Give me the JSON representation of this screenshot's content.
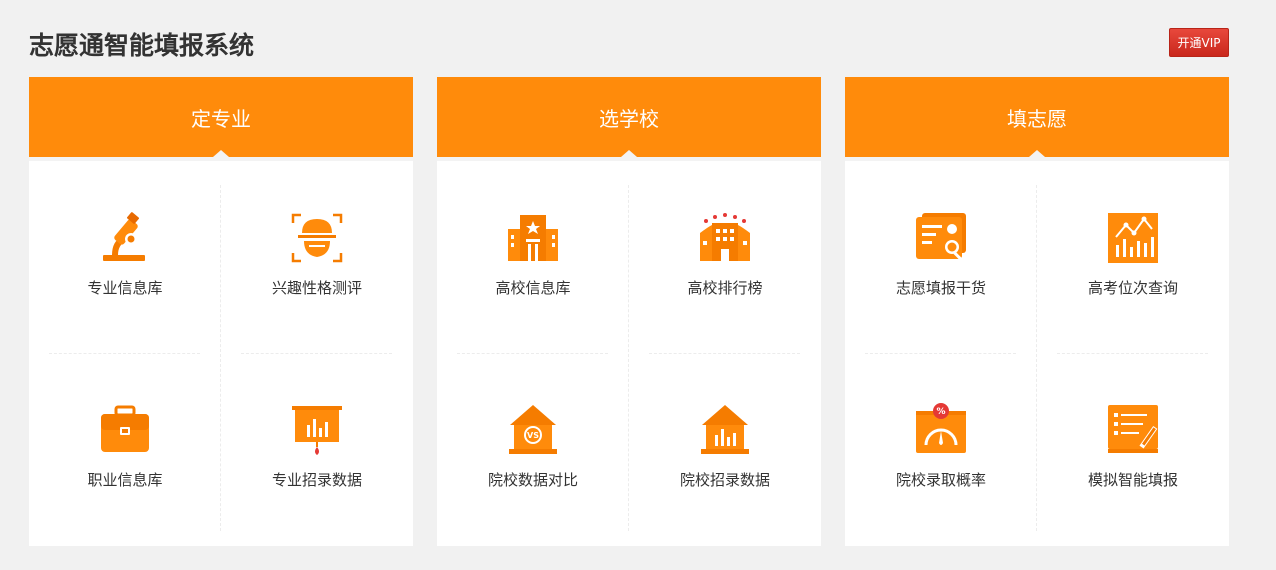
{
  "page": {
    "title": "志愿通智能填报系统",
    "vip_button": "开通VIP"
  },
  "colors": {
    "accent": "#ff8b0b",
    "icon_orange": "#f57c00",
    "vip_red": "#d9342a"
  },
  "panels": [
    {
      "header": "定专业",
      "items": [
        {
          "label": "专业信息库",
          "icon": "microscope-icon"
        },
        {
          "label": "兴趣性格测评",
          "icon": "face-scan-icon"
        },
        {
          "label": "职业信息库",
          "icon": "briefcase-icon"
        },
        {
          "label": "专业招录数据",
          "icon": "presentation-chart-icon"
        }
      ]
    },
    {
      "header": "选学校",
      "items": [
        {
          "label": "高校信息库",
          "icon": "university-building-icon"
        },
        {
          "label": "高校排行榜",
          "icon": "ranked-building-icon"
        },
        {
          "label": "院校数据对比",
          "icon": "house-vs-icon"
        },
        {
          "label": "院校招录数据",
          "icon": "house-chart-icon"
        }
      ]
    },
    {
      "header": "填志愿",
      "items": [
        {
          "label": "志愿填报干货",
          "icon": "document-search-icon"
        },
        {
          "label": "高考位次查询",
          "icon": "line-chart-icon"
        },
        {
          "label": "院校录取概率",
          "icon": "gauge-percent-icon"
        },
        {
          "label": "模拟智能填报",
          "icon": "form-pencil-icon"
        }
      ]
    }
  ]
}
